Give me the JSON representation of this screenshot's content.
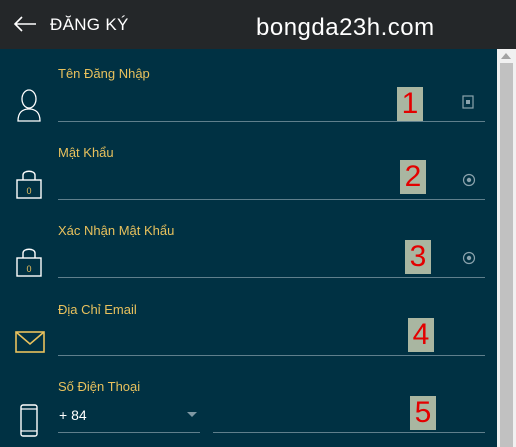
{
  "header": {
    "back_icon": "arrow-left-icon",
    "title": "ĐĂNG KÝ",
    "watermark": "bongda23h.com"
  },
  "form": {
    "fields": [
      {
        "label": "Tên Đăng Nhập",
        "icon": "user-icon",
        "trailing_icon": "id-card-icon",
        "value": "",
        "badge": "1"
      },
      {
        "label": "Mật Khẩu",
        "icon": "lock-icon",
        "trailing_icon": "eye-icon",
        "value": "",
        "badge": "2",
        "lock_digit": "0"
      },
      {
        "label": "Xác Nhận Mật Khẩu",
        "icon": "lock-icon",
        "trailing_icon": "eye-icon",
        "value": "",
        "badge": "3",
        "lock_digit": "0"
      },
      {
        "label": "Địa Chỉ Email",
        "icon": "envelope-icon",
        "value": "",
        "badge": "4"
      },
      {
        "label": "Số Điện Thoại",
        "icon": "phone-icon",
        "country_code": "+ 84",
        "value": "",
        "badge": "5"
      }
    ]
  },
  "colors": {
    "background": "#003143",
    "topbar": "#242729",
    "label": "#e8c15d",
    "badge_bg": "#a9b6a1",
    "badge_text": "#e30000"
  }
}
